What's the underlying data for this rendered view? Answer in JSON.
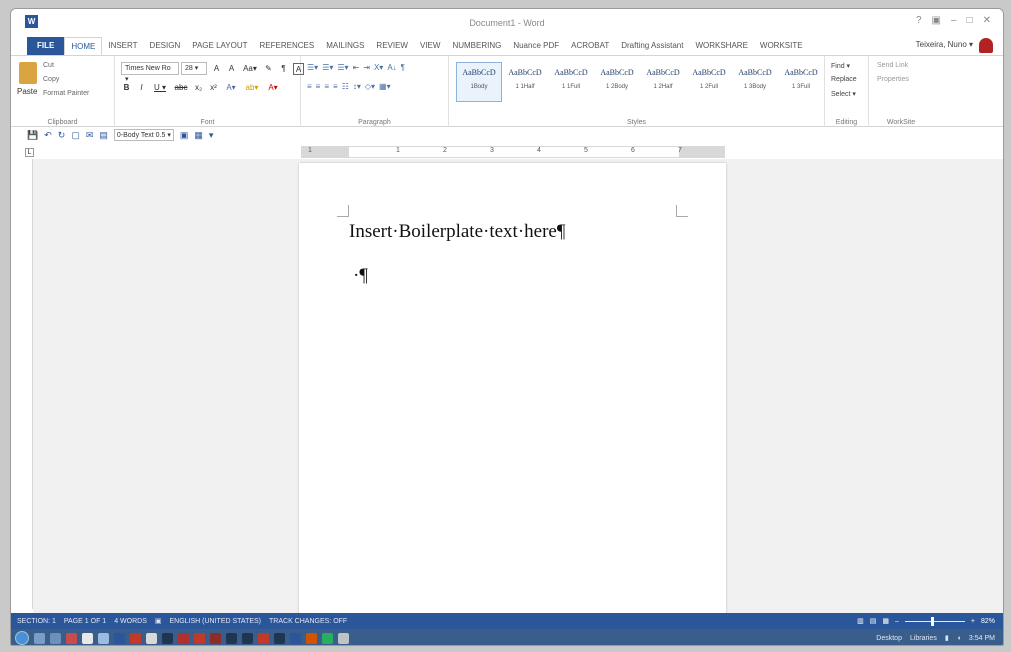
{
  "titlebar": {
    "app_icon": "W",
    "title": "Document1 - Word",
    "controls": [
      "?",
      "▣",
      "–",
      "□",
      "✕"
    ]
  },
  "tabs": [
    "FILE",
    "HOME",
    "INSERT",
    "DESIGN",
    "PAGE LAYOUT",
    "REFERENCES",
    "MAILINGS",
    "REVIEW",
    "VIEW",
    "NUMBERING",
    "Nuance PDF",
    "ACROBAT",
    "Drafting Assistant",
    "WORKSHARE",
    "WORKSITE"
  ],
  "user": {
    "name": "Teixeira, Nuno ▾"
  },
  "ribbon": {
    "clipboard": {
      "paste": "Paste",
      "cut": "Cut",
      "copy": "Copy",
      "format_painter": "Format Painter",
      "label": "Clipboard"
    },
    "font": {
      "family": "Times New Ro ▾",
      "size": "28 ▾",
      "label": "Font",
      "row1": [
        "A",
        "A",
        "Aa▾",
        "✎",
        "¶",
        "A"
      ],
      "row2": [
        "B",
        "I",
        "U ▾",
        "abc",
        "x₂",
        "x²",
        "A▾",
        "ab▾",
        "A▾"
      ]
    },
    "paragraph": {
      "label": "Paragraph",
      "row1": [
        "☰▾",
        "☰▾",
        "☰▾",
        "⇤",
        "⇥",
        "X▾",
        "A↓",
        "¶"
      ],
      "row2": [
        "≡",
        "≡",
        "≡",
        "≡",
        "☷",
        "↕▾",
        "◇▾",
        "▦▾"
      ]
    },
    "styles": {
      "label": "Styles",
      "items": [
        {
          "preview": "AaBbCcD",
          "name": "1Body"
        },
        {
          "preview": "AaBbCcD",
          "name": "1 1Half"
        },
        {
          "preview": "AaBbCcD",
          "name": "1 1Full"
        },
        {
          "preview": "AaBbCcD",
          "name": "1 2Body"
        },
        {
          "preview": "AaBbCcD",
          "name": "1 2Half"
        },
        {
          "preview": "AaBbCcD",
          "name": "1 2Full"
        },
        {
          "preview": "AaBbCcD",
          "name": "1 3Body"
        },
        {
          "preview": "AaBbCcD",
          "name": "1 3Full"
        }
      ]
    },
    "editing": {
      "find": "Find ▾",
      "replace": "Replace",
      "select": "Select ▾",
      "label": "Editing"
    },
    "worksite": {
      "send_link": "Send Link",
      "properties": "Properties",
      "label": "WorkSite"
    }
  },
  "qat": {
    "style_box": "0-Body Text 0.5 ▾"
  },
  "ruler": {
    "h": [
      "1",
      "1",
      "2",
      "3",
      "4",
      "5",
      "6",
      "7"
    ]
  },
  "document": {
    "line1": "Insert·Boilerplate·text·here¶",
    "line2": "·¶"
  },
  "statusbar": {
    "section": "SECTION: 1",
    "page": "PAGE 1 OF 1",
    "words": "4 WORDS",
    "language": "ENGLISH (UNITED STATES)",
    "track": "TRACK CHANGES: OFF",
    "zoom": "82%"
  },
  "taskbar": {
    "desktop": "Desktop",
    "libraries": "Libraries",
    "time": "3:54 PM"
  },
  "colors": {
    "accent": "#2b579a",
    "taskbar": "#3a5e8c"
  }
}
